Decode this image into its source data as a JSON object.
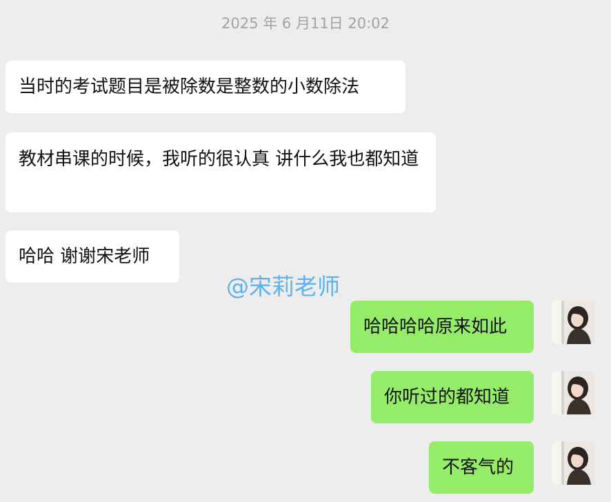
{
  "chat": {
    "timestamp": "2025 年 6 月11日 20:02",
    "messages": [
      {
        "sender": "other",
        "text": "当时的考试题目是被除数是整数的小数除法"
      },
      {
        "sender": "other",
        "text": "教材串课的时候，我听的很认真  讲什么我也都知道"
      },
      {
        "sender": "other",
        "text": "哈哈  谢谢宋老师"
      },
      {
        "sender": "me",
        "text": "哈哈哈哈原来如此"
      },
      {
        "sender": "me",
        "text": "你听过的都知道"
      },
      {
        "sender": "me",
        "text": "不客气的"
      }
    ],
    "watermark": "@宋莉老师"
  },
  "colors": {
    "background": "#ededed",
    "received_bubble": "#ffffff",
    "sent_bubble": "#95ec69",
    "timestamp_text": "#a2a2a2",
    "watermark": "#5db2ee"
  },
  "icons": {
    "avatar": "user-avatar-photo"
  }
}
